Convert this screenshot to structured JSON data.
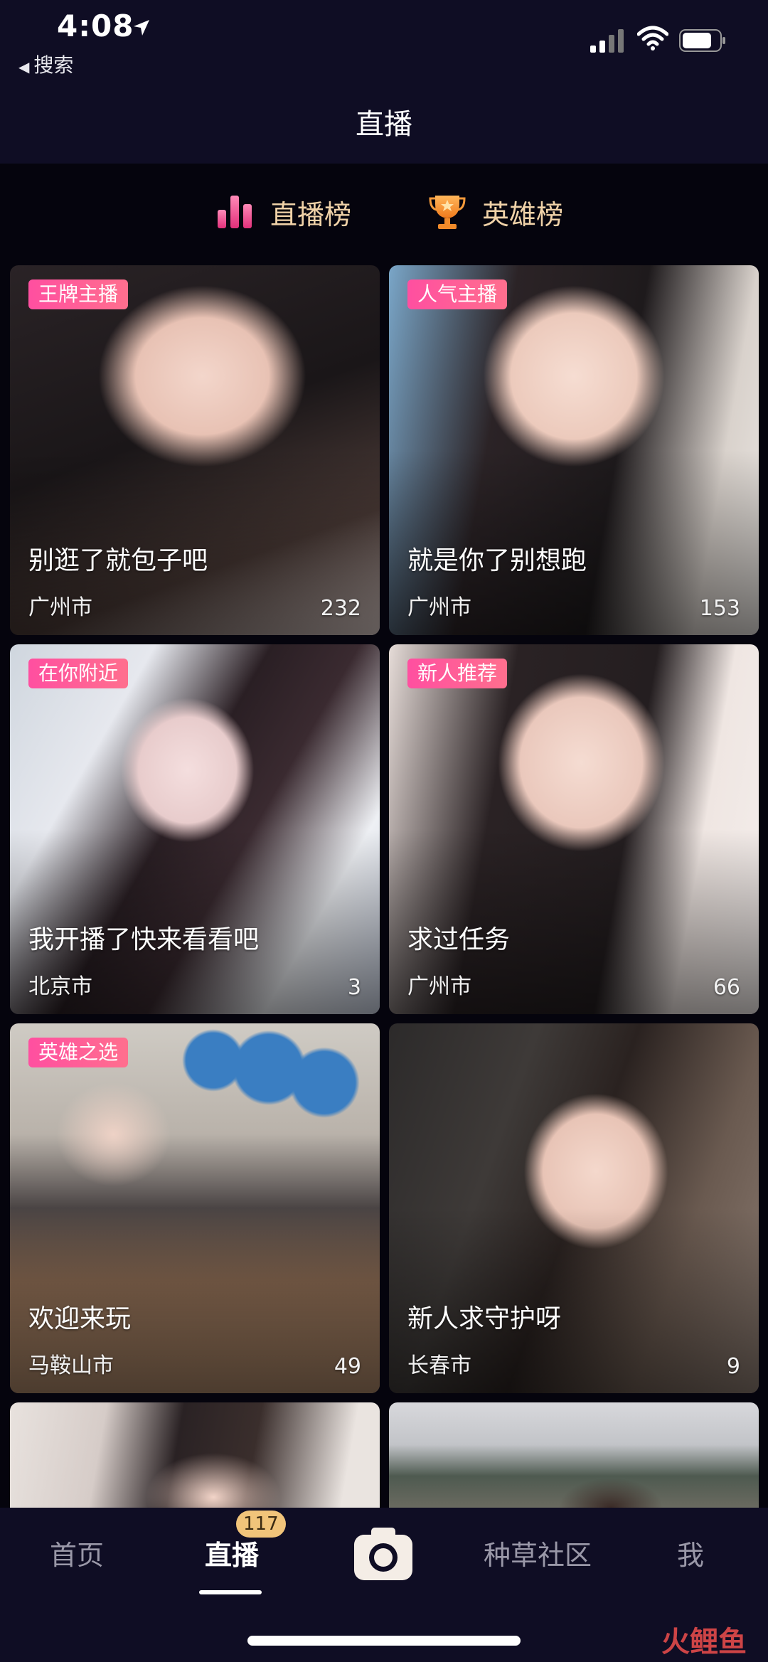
{
  "status": {
    "time": "4:08",
    "back_label": "搜索"
  },
  "header": {
    "title": "直播"
  },
  "ranks": [
    {
      "label": "直播榜",
      "icon": "bar-chart-icon"
    },
    {
      "label": "英雄榜",
      "icon": "trophy-icon"
    }
  ],
  "cards": [
    {
      "tag": "王牌主播",
      "caption": "别逛了就包子吧",
      "city": "广州市",
      "count": "232"
    },
    {
      "tag": "人气主播",
      "caption": "就是你了别想跑",
      "city": "广州市",
      "count": "153"
    },
    {
      "tag": "在你附近",
      "caption": "我开播了快来看看吧",
      "city": "北京市",
      "count": "3"
    },
    {
      "tag": "新人推荐",
      "caption": "求过任务",
      "city": "广州市",
      "count": "66"
    },
    {
      "tag": "英雄之选",
      "caption": "欢迎来玩",
      "city": "马鞍山市",
      "count": "49"
    },
    {
      "tag": "",
      "caption": "新人求守护呀",
      "city": "长春市",
      "count": "9"
    },
    {
      "tag": "",
      "caption": "",
      "city": "",
      "count": ""
    },
    {
      "tag": "",
      "caption": "",
      "city": "",
      "count": ""
    }
  ],
  "nav": {
    "home": "首页",
    "live": "直播",
    "live_badge": "117",
    "grass": "种草社区",
    "me": "我"
  },
  "watermark": "火鲤鱼",
  "colors": {
    "accent_pink": "#ff4fa0",
    "rank_gold": "#f0d2a8",
    "badge": "#f1c47a"
  }
}
